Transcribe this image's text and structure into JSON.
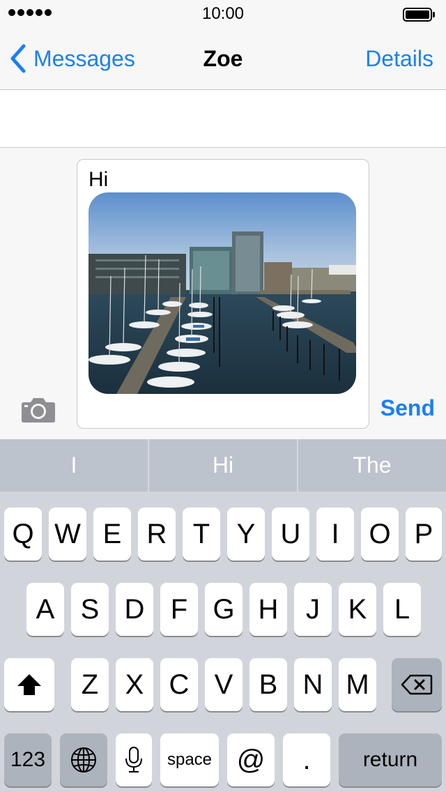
{
  "status": {
    "time": "10:00",
    "signal_bars": 5
  },
  "nav": {
    "back_label": "Messages",
    "title": "Zoe",
    "details_label": "Details"
  },
  "composer": {
    "text": "Hi",
    "send_label": "Send"
  },
  "predictions": [
    "I",
    "Hi",
    "The"
  ],
  "keyboard": {
    "row1": [
      "Q",
      "W",
      "E",
      "R",
      "T",
      "Y",
      "U",
      "I",
      "O",
      "P"
    ],
    "row2": [
      "A",
      "S",
      "D",
      "F",
      "G",
      "H",
      "J",
      "K",
      "L"
    ],
    "row3": [
      "Z",
      "X",
      "C",
      "V",
      "B",
      "N",
      "M"
    ],
    "numbers_label": "123",
    "space_label": "space",
    "at_label": "@",
    "period_label": ".",
    "return_label": "return"
  },
  "colors": {
    "accent": "#1a7ff5",
    "keyboard_bg": "#d1d5db",
    "prediction_bg": "#bcc3cd"
  }
}
